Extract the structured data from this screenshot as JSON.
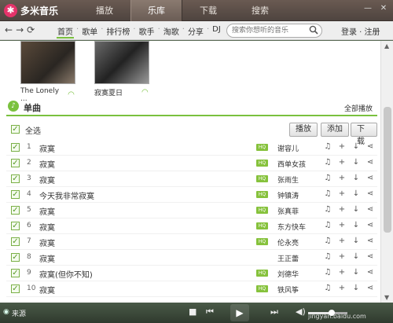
{
  "app": {
    "title": "多米音乐",
    "logo_char": "✱"
  },
  "tabs": [
    {
      "label": "播放",
      "active": false
    },
    {
      "label": "乐库",
      "active": true
    },
    {
      "label": "下载",
      "active": false
    },
    {
      "label": "搜索",
      "active": false
    }
  ],
  "nav": {
    "links": [
      "首页",
      "歌单",
      "排行榜",
      "歌手",
      "淘歌",
      "分享",
      "DJ"
    ],
    "active": "首页",
    "search_placeholder": "搜索你想听的音乐",
    "account": "登录 · 注册"
  },
  "albums": [
    {
      "title": "The Lonely ..."
    },
    {
      "title": "寂寞夏日"
    }
  ],
  "section": {
    "title": "单曲",
    "play_all": "全部播放"
  },
  "select_all": "全选",
  "actions": {
    "play": "播放",
    "add": "添加",
    "download": "下载"
  },
  "songs": [
    {
      "num": "1",
      "title": "寂寞",
      "hq": true,
      "artist": "谢容儿"
    },
    {
      "num": "2",
      "title": "寂寞",
      "hq": true,
      "artist": "西单女孩"
    },
    {
      "num": "3",
      "title": "寂寞",
      "hq": true,
      "artist": "张雨生"
    },
    {
      "num": "4",
      "title": "今天我非常寂寞",
      "hq": true,
      "artist": "钟镇涛"
    },
    {
      "num": "5",
      "title": "寂寞",
      "hq": true,
      "artist": "张真菲"
    },
    {
      "num": "6",
      "title": "寂寞",
      "hq": true,
      "artist": "东方快车"
    },
    {
      "num": "7",
      "title": "寂寞",
      "hq": true,
      "artist": "伦永亮"
    },
    {
      "num": "8",
      "title": "寂寞",
      "hq": false,
      "artist": "王正蕾"
    },
    {
      "num": "9",
      "title": "寂寞(但你不知)",
      "hq": true,
      "artist": "刘德华"
    },
    {
      "num": "10",
      "title": "寂寞",
      "hq": true,
      "artist": "铁风筝"
    }
  ],
  "hq_label": "HQ",
  "player": {
    "source": "来源",
    "watermark": "jingyan.baidu.com",
    "volume_fraction": 0.6
  },
  "colors": {
    "accent": "#7ac13e",
    "titlebar": "#4e443f",
    "brand": "#e5336a"
  }
}
